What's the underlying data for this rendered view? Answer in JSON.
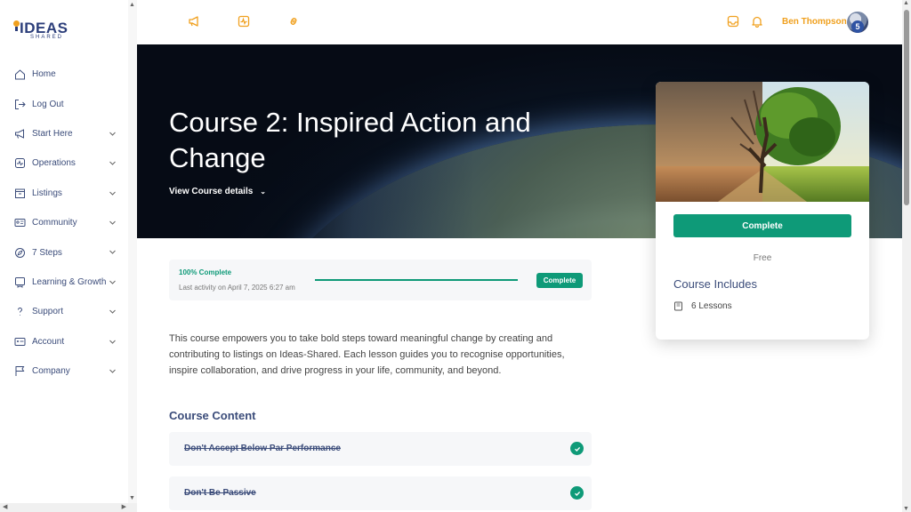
{
  "brand": {
    "logo_text": "IDEAS",
    "logo_sub": "SHARED"
  },
  "sidebar": {
    "items": [
      {
        "label": "Home",
        "icon": "home-icon",
        "has_chevron": false
      },
      {
        "label": "Log Out",
        "icon": "logout-icon",
        "has_chevron": false
      },
      {
        "label": "Start Here",
        "icon": "megaphone-icon",
        "has_chevron": true
      },
      {
        "label": "Operations",
        "icon": "activity-icon",
        "has_chevron": true
      },
      {
        "label": "Listings",
        "icon": "archive-icon",
        "has_chevron": true
      },
      {
        "label": "Community",
        "icon": "id-card-icon",
        "has_chevron": true
      },
      {
        "label": "7 Steps",
        "icon": "compass-icon",
        "has_chevron": true
      },
      {
        "label": "Learning & Growth",
        "icon": "shield-icon",
        "has_chevron": true
      },
      {
        "label": "Support",
        "icon": "question-icon",
        "has_chevron": true
      },
      {
        "label": "Account",
        "icon": "account-card-icon",
        "has_chevron": true
      },
      {
        "label": "Company",
        "icon": "flag-icon",
        "has_chevron": true
      }
    ]
  },
  "topbar": {
    "icons": [
      "megaphone-icon",
      "activity-icon",
      "link-icon"
    ],
    "right_icons": [
      "inbox-icon",
      "bell-icon"
    ],
    "user_name": "Ben Thompson",
    "avatar_badge": "5"
  },
  "hero": {
    "title": "Course 2: Inspired Action and Change",
    "details_link": "View Course details"
  },
  "card": {
    "button_label": "Complete",
    "price": "Free",
    "includes_title": "Course Includes",
    "lessons": "6 Lessons"
  },
  "progress": {
    "percent_label": "100% Complete",
    "percent_value": 100,
    "last_activity": "Last activity on April 7, 2025 6:27 am",
    "button_label": "Complete"
  },
  "description": "This course empowers you to take bold steps toward meaningful change by creating and contributing to listings on Ideas-Shared. Each lesson guides you to recognise opportunities, inspire collaboration, and drive progress in your life, community, and beyond.",
  "content": {
    "title": "Course Content",
    "lessons": [
      {
        "title": "Don't Accept Below Par Performance",
        "completed": true
      },
      {
        "title": "Don't Be Passive",
        "completed": true
      }
    ]
  },
  "colors": {
    "accent": "#0e9a78",
    "nav_text": "#3b4c7a",
    "user": "#f0a01e"
  }
}
